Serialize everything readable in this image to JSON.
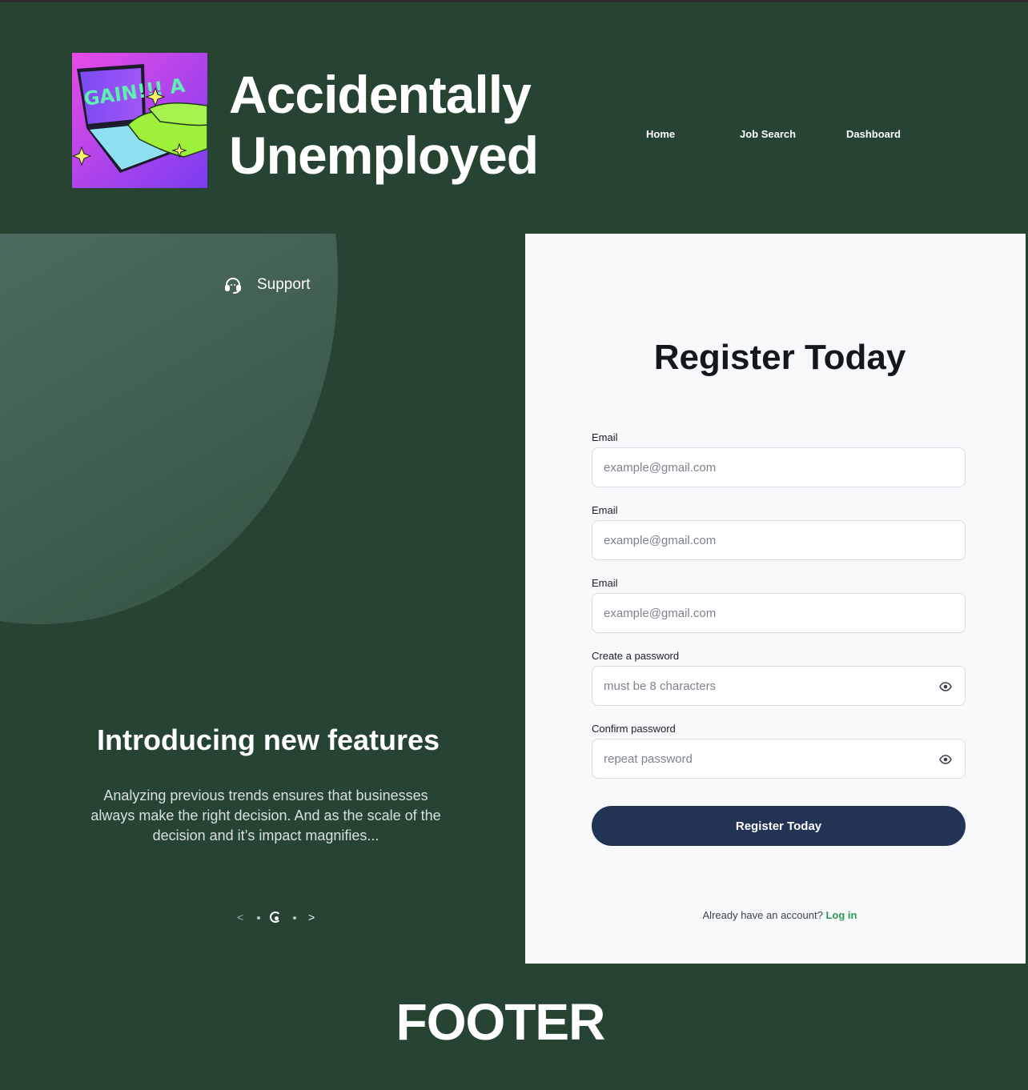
{
  "header": {
    "logo_text": "GAIN!!! A",
    "brand_line1": "Accidentally",
    "brand_line2": "Unemployed",
    "nav": [
      {
        "label": "Home"
      },
      {
        "label": "Job Search"
      },
      {
        "label": "Dashboard"
      }
    ]
  },
  "promo": {
    "support_label": "Support",
    "title": "Introducing new features",
    "text": "Analyzing previous trends ensures that businesses always make the right decision. And as the scale of the decision and it’s impact magnifies...",
    "prev_label": "<",
    "next_label": ">"
  },
  "form": {
    "title": "Register Today",
    "fields": [
      {
        "label": "Email",
        "placeholder": "example@gmail.com"
      },
      {
        "label": "Email",
        "placeholder": "example@gmail.com"
      },
      {
        "label": "Email",
        "placeholder": "example@gmail.com"
      },
      {
        "label": "Create a password",
        "placeholder": "must be 8 characters"
      },
      {
        "label": "Confirm password",
        "placeholder": "repeat password"
      }
    ],
    "submit_label": "Register Today",
    "login_prompt": "Already have an account?",
    "login_link": "Log in"
  },
  "footer": {
    "label": "FOOTER"
  },
  "colors": {
    "background": "#274433",
    "card": "#f8f9fb",
    "button": "#223354",
    "link": "#2f9a55"
  }
}
